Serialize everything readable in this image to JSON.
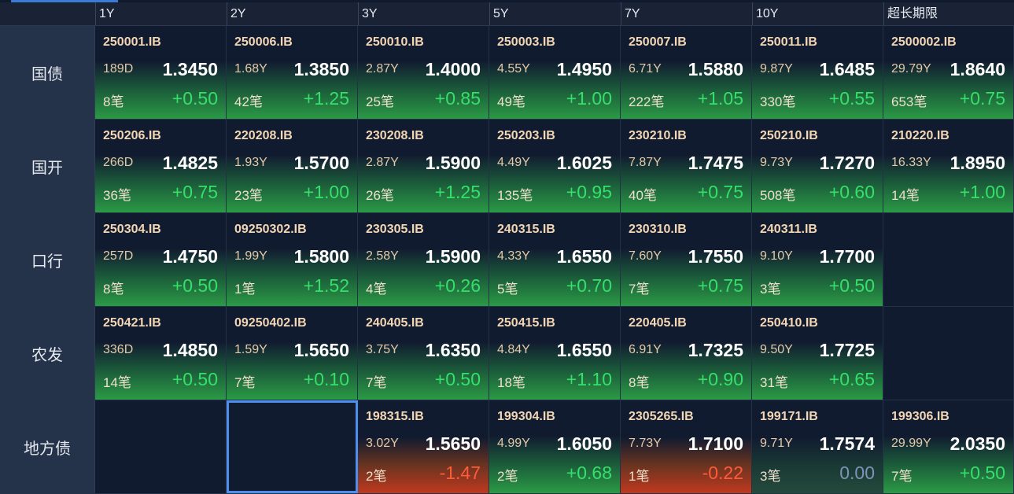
{
  "header": {
    "columns": [
      "1Y",
      "2Y",
      "3Y",
      "5Y",
      "7Y",
      "10Y",
      "超长期限"
    ]
  },
  "rows": [
    {
      "label": "国债",
      "cells": [
        {
          "code": "250001.IB",
          "tenor": "189D",
          "rate": "1.3450",
          "count": "8笔",
          "change": "+0.50",
          "trend": "up"
        },
        {
          "code": "250006.IB",
          "tenor": "1.68Y",
          "rate": "1.3850",
          "count": "42笔",
          "change": "+1.25",
          "trend": "up"
        },
        {
          "code": "250010.IB",
          "tenor": "2.87Y",
          "rate": "1.4000",
          "count": "25笔",
          "change": "+0.85",
          "trend": "up"
        },
        {
          "code": "250003.IB",
          "tenor": "4.55Y",
          "rate": "1.4950",
          "count": "49笔",
          "change": "+1.00",
          "trend": "up"
        },
        {
          "code": "250007.IB",
          "tenor": "6.71Y",
          "rate": "1.5880",
          "count": "222笔",
          "change": "+1.05",
          "trend": "up"
        },
        {
          "code": "250011.IB",
          "tenor": "9.87Y",
          "rate": "1.6485",
          "count": "330笔",
          "change": "+0.55",
          "trend": "up"
        },
        {
          "code": "2500002.IB",
          "tenor": "29.79Y",
          "rate": "1.8640",
          "count": "653笔",
          "change": "+0.75",
          "trend": "up"
        }
      ]
    },
    {
      "label": "国开",
      "cells": [
        {
          "code": "250206.IB",
          "tenor": "266D",
          "rate": "1.4825",
          "count": "36笔",
          "change": "+0.75",
          "trend": "up"
        },
        {
          "code": "220208.IB",
          "tenor": "1.93Y",
          "rate": "1.5700",
          "count": "23笔",
          "change": "+1.00",
          "trend": "up"
        },
        {
          "code": "230208.IB",
          "tenor": "2.87Y",
          "rate": "1.5900",
          "count": "26笔",
          "change": "+1.25",
          "trend": "up"
        },
        {
          "code": "250203.IB",
          "tenor": "4.49Y",
          "rate": "1.6025",
          "count": "135笔",
          "change": "+0.95",
          "trend": "up"
        },
        {
          "code": "230210.IB",
          "tenor": "7.87Y",
          "rate": "1.7475",
          "count": "40笔",
          "change": "+0.75",
          "trend": "up"
        },
        {
          "code": "250210.IB",
          "tenor": "9.73Y",
          "rate": "1.7270",
          "count": "508笔",
          "change": "+0.60",
          "trend": "up"
        },
        {
          "code": "210220.IB",
          "tenor": "16.33Y",
          "rate": "1.8950",
          "count": "14笔",
          "change": "+1.00",
          "trend": "up"
        }
      ]
    },
    {
      "label": "口行",
      "cells": [
        {
          "code": "250304.IB",
          "tenor": "257D",
          "rate": "1.4750",
          "count": "8笔",
          "change": "+0.50",
          "trend": "up"
        },
        {
          "code": "09250302.IB",
          "tenor": "1.99Y",
          "rate": "1.5800",
          "count": "1笔",
          "change": "+1.52",
          "trend": "up"
        },
        {
          "code": "230305.IB",
          "tenor": "2.58Y",
          "rate": "1.5900",
          "count": "4笔",
          "change": "+0.26",
          "trend": "up"
        },
        {
          "code": "240315.IB",
          "tenor": "4.33Y",
          "rate": "1.6550",
          "count": "5笔",
          "change": "+0.70",
          "trend": "up"
        },
        {
          "code": "230310.IB",
          "tenor": "7.60Y",
          "rate": "1.7550",
          "count": "7笔",
          "change": "+0.75",
          "trend": "up"
        },
        {
          "code": "240311.IB",
          "tenor": "9.10Y",
          "rate": "1.7700",
          "count": "3笔",
          "change": "+0.50",
          "trend": "up"
        },
        null
      ]
    },
    {
      "label": "农发",
      "cells": [
        {
          "code": "250421.IB",
          "tenor": "336D",
          "rate": "1.4850",
          "count": "14笔",
          "change": "+0.50",
          "trend": "up"
        },
        {
          "code": "09250402.IB",
          "tenor": "1.59Y",
          "rate": "1.5650",
          "count": "7笔",
          "change": "+0.10",
          "trend": "up"
        },
        {
          "code": "240405.IB",
          "tenor": "3.75Y",
          "rate": "1.6350",
          "count": "7笔",
          "change": "+0.50",
          "trend": "up"
        },
        {
          "code": "250415.IB",
          "tenor": "4.84Y",
          "rate": "1.6550",
          "count": "18笔",
          "change": "+1.10",
          "trend": "up"
        },
        {
          "code": "220405.IB",
          "tenor": "6.91Y",
          "rate": "1.7325",
          "count": "8笔",
          "change": "+0.90",
          "trend": "up"
        },
        {
          "code": "250410.IB",
          "tenor": "9.50Y",
          "rate": "1.7725",
          "count": "31笔",
          "change": "+0.65",
          "trend": "up"
        },
        null
      ]
    },
    {
      "label": "地方债",
      "cells": [
        null,
        {
          "selected": true
        },
        {
          "code": "198315.IB",
          "tenor": "3.02Y",
          "rate": "1.5650",
          "count": "2笔",
          "change": "-1.47",
          "trend": "down"
        },
        {
          "code": "199304.IB",
          "tenor": "4.99Y",
          "rate": "1.6050",
          "count": "2笔",
          "change": "+0.68",
          "trend": "up"
        },
        {
          "code": "2305265.IB",
          "tenor": "7.73Y",
          "rate": "1.7100",
          "count": "1笔",
          "change": "-0.22",
          "trend": "down"
        },
        {
          "code": "199171.IB",
          "tenor": "9.71Y",
          "rate": "1.7574",
          "count": "3笔",
          "change": "0.00",
          "trend": "flat"
        },
        {
          "code": "199306.IB",
          "tenor": "29.99Y",
          "rate": "2.0350",
          "count": "7笔",
          "change": "+0.50",
          "trend": "up"
        }
      ]
    }
  ],
  "colors": {
    "up": "#35e06a",
    "down": "#ff5a3a",
    "flat": "#7f93b8",
    "selected_border": "#4d8ff0"
  }
}
